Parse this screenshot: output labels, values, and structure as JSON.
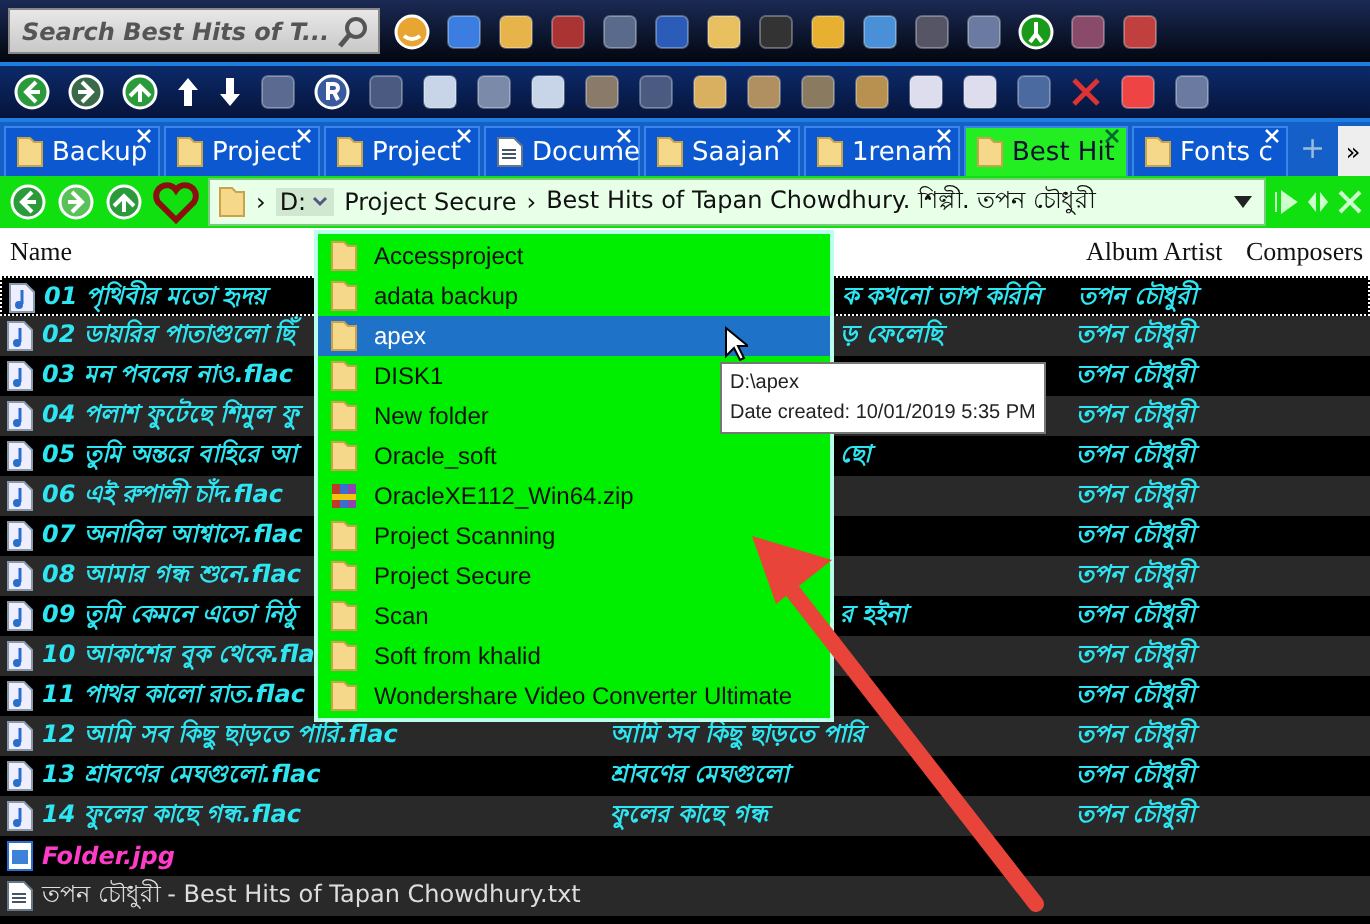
{
  "search": {
    "placeholder": "Search Best Hits of T..."
  },
  "tabs": [
    {
      "label": "Backup",
      "kind": "folder",
      "selected": false
    },
    {
      "label": "Project",
      "kind": "folder",
      "selected": false
    },
    {
      "label": "Project",
      "kind": "folder",
      "selected": false
    },
    {
      "label": "Docume",
      "kind": "document",
      "selected": false
    },
    {
      "label": "Saajan",
      "kind": "folder",
      "selected": false
    },
    {
      "label": "1renam",
      "kind": "folder",
      "selected": false
    },
    {
      "label": "Best Hit",
      "kind": "folder",
      "selected": true
    },
    {
      "label": "Fonts c",
      "kind": "folder",
      "selected": false
    }
  ],
  "tab_add": "+",
  "tab_more": "»",
  "address": {
    "separator": "›",
    "drive": "D:",
    "crumbs": [
      "Project Secure",
      "Best Hits of Tapan Chowdhury. শিল্পী. তপন চৌধুরী"
    ]
  },
  "columns": {
    "name": "Name",
    "album_artist": "Album Artist",
    "composers": "Composers"
  },
  "rows": [
    {
      "kind": "audio",
      "name": "01 পৃথিবীর মতো হৃদয়",
      "title": "ক কখনো তাপ করিনি",
      "album_artist": "তপন চৌধুরী",
      "focused": true
    },
    {
      "kind": "audio",
      "name": "02 ডায়রির পাতাগুলো ছিঁ",
      "title": "ড় ফেলেছি",
      "album_artist": "তপন চৌধুরী",
      "focused": false
    },
    {
      "kind": "audio",
      "name": "03 মন পবনের নাও.flac",
      "album_artist": "তপন চৌধুরী",
      "focused": false
    },
    {
      "kind": "audio",
      "name": "04 পলাশ ফুটেছে শিমুল ফু",
      "album_artist": "তপন চৌধুরী",
      "focused": false
    },
    {
      "kind": "audio",
      "name": "05 তুমি অন্তরে বাহিরে আ",
      "title": "ছো",
      "album_artist": "তপন চৌধুরী",
      "focused": false
    },
    {
      "kind": "audio",
      "name": "06 এই রুপালী চাঁদ.flac",
      "album_artist": "তপন চৌধুরী",
      "focused": false
    },
    {
      "kind": "audio",
      "name": "07 অনাবিল আশ্বাসে.flac",
      "album_artist": "তপন চৌধুরী",
      "focused": false
    },
    {
      "kind": "audio",
      "name": "08 আমার গন্ধ শুনে.flac",
      "album_artist": "তপন চৌধুরী",
      "focused": false
    },
    {
      "kind": "audio",
      "name": "09 তুমি কেমনে এতো নিঠু",
      "title": "র হইনা",
      "album_artist": "তপন চৌধুরী",
      "focused": false
    },
    {
      "kind": "audio",
      "name": "10 আকাশের বুক থেকে.fla",
      "album_artist": "তপন চৌধুরী",
      "focused": false
    },
    {
      "kind": "audio",
      "name": "11 পাথর কালো রাত.flac",
      "album_artist": "তপন চৌধুরী",
      "focused": false
    },
    {
      "kind": "audio",
      "name": "12 আমি সব কিছু ছাড়তে পারি.flac",
      "title": "আমি সব কিছু ছাড়তে পারি",
      "album_artist": "তপন চৌধুরী",
      "focused": false
    },
    {
      "kind": "audio",
      "name": "13 শ্রাবণের মেঘগুলো.flac",
      "title": "শ্রাবণের মেঘগুলো",
      "album_artist": "তপন চৌধুরী",
      "focused": false
    },
    {
      "kind": "audio",
      "name": "14 ফুলের কাছে গন্ধ.flac",
      "title": "ফুলের কাছে গন্ধ",
      "album_artist": "তপন চৌধুরী",
      "focused": false
    },
    {
      "kind": "image",
      "name": "Folder.jpg",
      "focused": false
    },
    {
      "kind": "text",
      "name": "তপন চৌধুরী - Best Hits of Tapan Chowdhury.txt",
      "focused": false
    }
  ],
  "dropdown": [
    {
      "label": "Accessproject",
      "kind": "folder",
      "selected": false
    },
    {
      "label": "adata backup",
      "kind": "folder",
      "selected": false
    },
    {
      "label": "apex",
      "kind": "folder",
      "selected": true
    },
    {
      "label": "DISK1",
      "kind": "folder",
      "selected": false
    },
    {
      "label": "New folder",
      "kind": "folder",
      "selected": false
    },
    {
      "label": "Oracle_soft",
      "kind": "folder",
      "selected": false
    },
    {
      "label": "OracleXE112_Win64.zip",
      "kind": "archive",
      "selected": false
    },
    {
      "label": "Project Scanning",
      "kind": "folder",
      "selected": false
    },
    {
      "label": "Project Secure",
      "kind": "folder",
      "selected": false
    },
    {
      "label": "Scan",
      "kind": "folder",
      "selected": false
    },
    {
      "label": "Soft from khalid",
      "kind": "folder",
      "selected": false
    },
    {
      "label": "Wondershare Video Converter Ultimate",
      "kind": "folder",
      "selected": false
    }
  ],
  "tooltip": {
    "path": "D:\\apex",
    "date": "Date created: 10/01/2019 5:35 PM"
  }
}
